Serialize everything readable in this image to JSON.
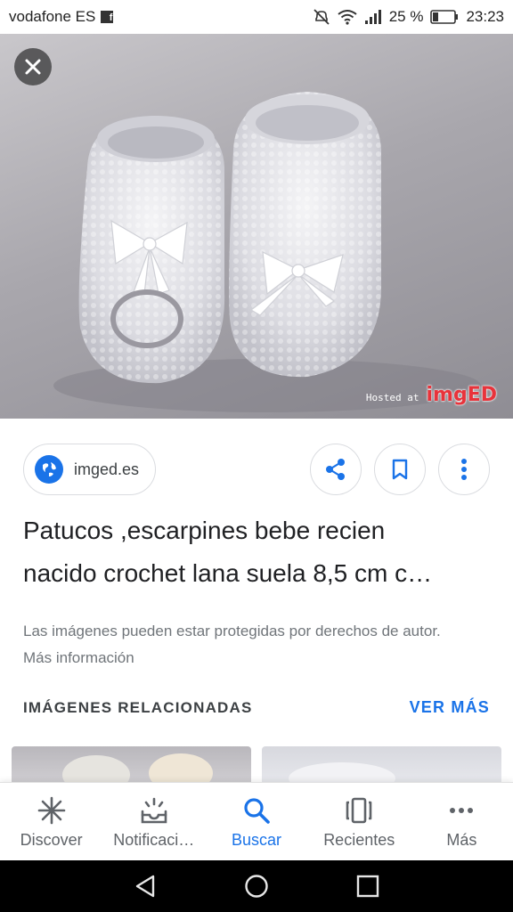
{
  "status_bar": {
    "carrier": "vodafone ES",
    "battery": "25 %",
    "time": "23:23"
  },
  "image_viewer": {
    "watermark_hosted": "Hosted at",
    "watermark_brand": "imgED"
  },
  "source": {
    "domain": "imged.es"
  },
  "result": {
    "title_line1": "Patucos ,escarpines bebe recien",
    "title_line2": "nacido crochet lana suela 8,5 cm c…",
    "copyright_notice": "Las imágenes pueden estar protegidas por derechos de autor. Más información"
  },
  "related": {
    "heading": "IMÁGENES RELACIONADAS",
    "see_more": "VER MÁS"
  },
  "bottom_nav": {
    "items": [
      {
        "label": "Discover",
        "icon": "asterisk-icon"
      },
      {
        "label": "Notificaci…",
        "icon": "notifications-tray-icon"
      },
      {
        "label": "Buscar",
        "icon": "search-icon"
      },
      {
        "label": "Recientes",
        "icon": "recent-cards-icon"
      },
      {
        "label": "Más",
        "icon": "more-dots-icon"
      }
    ],
    "active_index": 2
  },
  "colors": {
    "accent": "#1a73e8",
    "text_primary": "#202124",
    "text_secondary": "#70757a"
  }
}
